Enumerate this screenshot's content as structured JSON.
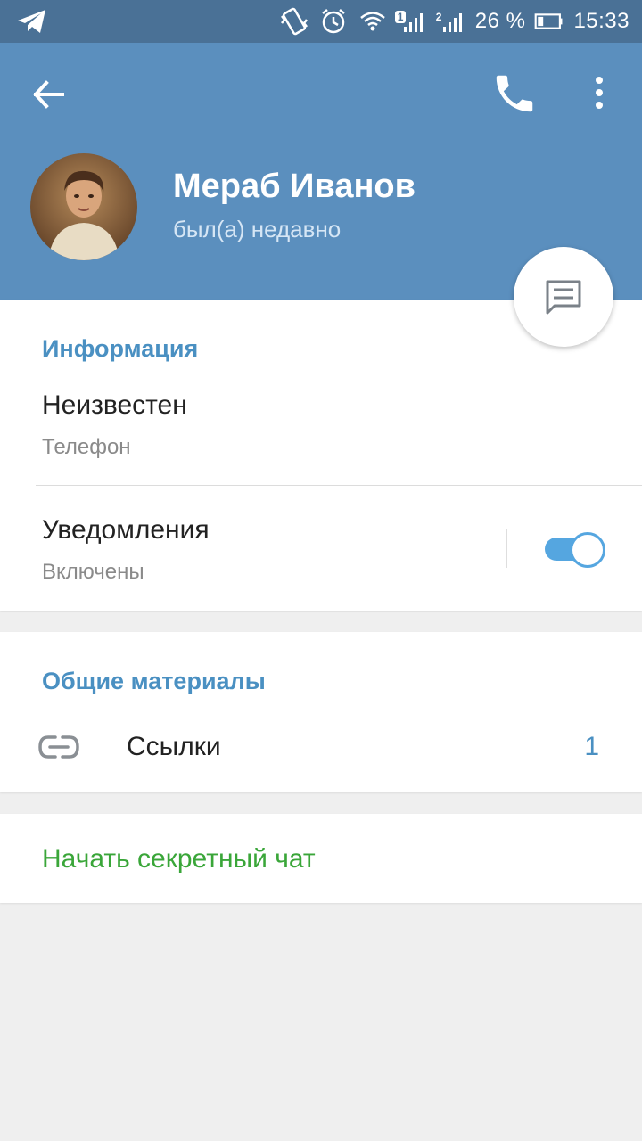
{
  "status_bar": {
    "battery_text": "26 %",
    "time": "15:33",
    "sim1_label": "1",
    "sim2_label": "2"
  },
  "profile": {
    "name": "Мераб Иванов",
    "status": "был(а) недавно"
  },
  "info_section": {
    "header": "Информация",
    "phone_value": "Неизвестен",
    "phone_label": "Телефон",
    "notifications_title": "Уведомления",
    "notifications_status": "Включены",
    "notifications_enabled": true
  },
  "media_section": {
    "header": "Общие материалы",
    "links_label": "Ссылки",
    "links_count": "1"
  },
  "secret_chat_label": "Начать секретный чат",
  "colors": {
    "status_bar": "#4a7196",
    "header": "#5b8fbe",
    "accent_blue": "#4a90c2",
    "toggle_on": "#55a6e0",
    "secret_green": "#3aa639",
    "background": "#efefef"
  },
  "icons": [
    "telegram-icon",
    "vibrate-icon",
    "alarm-icon",
    "wifi-icon",
    "signal-icon",
    "battery-icon",
    "back-arrow-icon",
    "phone-icon",
    "more-vert-icon",
    "message-icon",
    "link-icon"
  ]
}
